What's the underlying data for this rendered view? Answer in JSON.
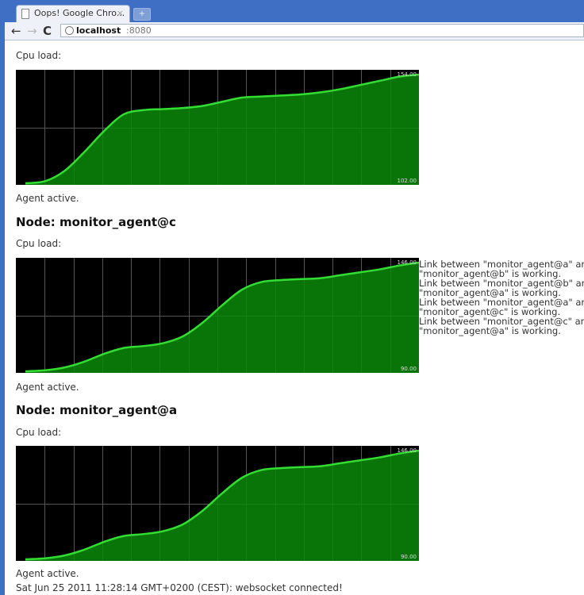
{
  "browser": {
    "tab_title": "Oops! Google Chro...",
    "tab_close": "×",
    "new_tab": "+",
    "nav": {
      "back": "←",
      "forward": "→",
      "reload": "C"
    },
    "url_host": "localhost",
    "url_port": ":8080"
  },
  "page": {
    "cpu_label": "Cpu load:",
    "agent_status": "Agent active.",
    "nodes": [
      {
        "title": ""
      },
      {
        "title": "Node: monitor_agent@c"
      },
      {
        "title": "Node: monitor_agent@a"
      }
    ],
    "links": [
      {
        "line1": "Link between \"monitor_agent@a\" and",
        "line2": "\"monitor_agent@b\" is working."
      },
      {
        "line1": "Link between \"monitor_agent@b\" and",
        "line2": "\"monitor_agent@a\" is working."
      },
      {
        "line1": "Link between \"monitor_agent@a\" and",
        "line2": "\"monitor_agent@c\" is working."
      },
      {
        "line1": "Link between \"monitor_agent@c\" and",
        "line2": "\"monitor_agent@a\" is working."
      }
    ],
    "status_message": "Sat Jun 25 2011 11:28:14 GMT+0200 (CEST): websocket connected!"
  },
  "colors": {
    "chart_bg": "#000000",
    "chart_fill": "#0a8a0a",
    "chart_line": "#33dd33",
    "grid": "#555555"
  },
  "chart_data": [
    {
      "type": "area",
      "title": "Cpu load:",
      "ylim": [
        102.0,
        154.0
      ],
      "max_label": "154.00",
      "min_label": "102.00",
      "x": [
        0,
        1,
        2,
        3,
        4,
        5,
        6,
        7,
        8,
        9,
        10,
        11,
        12,
        13,
        14,
        15,
        16,
        17,
        18,
        19,
        20
      ],
      "values": [
        102,
        103,
        108,
        117,
        127,
        135,
        137,
        137.5,
        138,
        139,
        141,
        143,
        143.5,
        144,
        144.5,
        145.5,
        147,
        149,
        151,
        153,
        154
      ]
    },
    {
      "type": "area",
      "title": "Cpu load:",
      "ylim": [
        90.0,
        146.0
      ],
      "max_label": "146.00",
      "min_label": "90.00",
      "x": [
        0,
        1,
        2,
        3,
        4,
        5,
        6,
        7,
        8,
        9,
        10,
        11,
        12,
        13,
        14,
        15,
        16,
        17,
        18,
        19,
        20
      ],
      "values": [
        90,
        90.5,
        92,
        95,
        99,
        102,
        103,
        104.5,
        108,
        115,
        124,
        132,
        136,
        137,
        137.5,
        138,
        139.5,
        141,
        142.5,
        144.5,
        146
      ]
    },
    {
      "type": "area",
      "title": "Cpu load:",
      "ylim": [
        90.0,
        146.0
      ],
      "max_label": "146.00",
      "min_label": "90.00",
      "x": [
        0,
        1,
        2,
        3,
        4,
        5,
        6,
        7,
        8,
        9,
        10,
        11,
        12,
        13,
        14,
        15,
        16,
        17,
        18,
        19,
        20
      ],
      "values": [
        90,
        90.5,
        92,
        95,
        99,
        102,
        103,
        104.5,
        108,
        115,
        124,
        132,
        136,
        137,
        137.5,
        138,
        139.5,
        141,
        142.5,
        144.5,
        146
      ]
    }
  ]
}
